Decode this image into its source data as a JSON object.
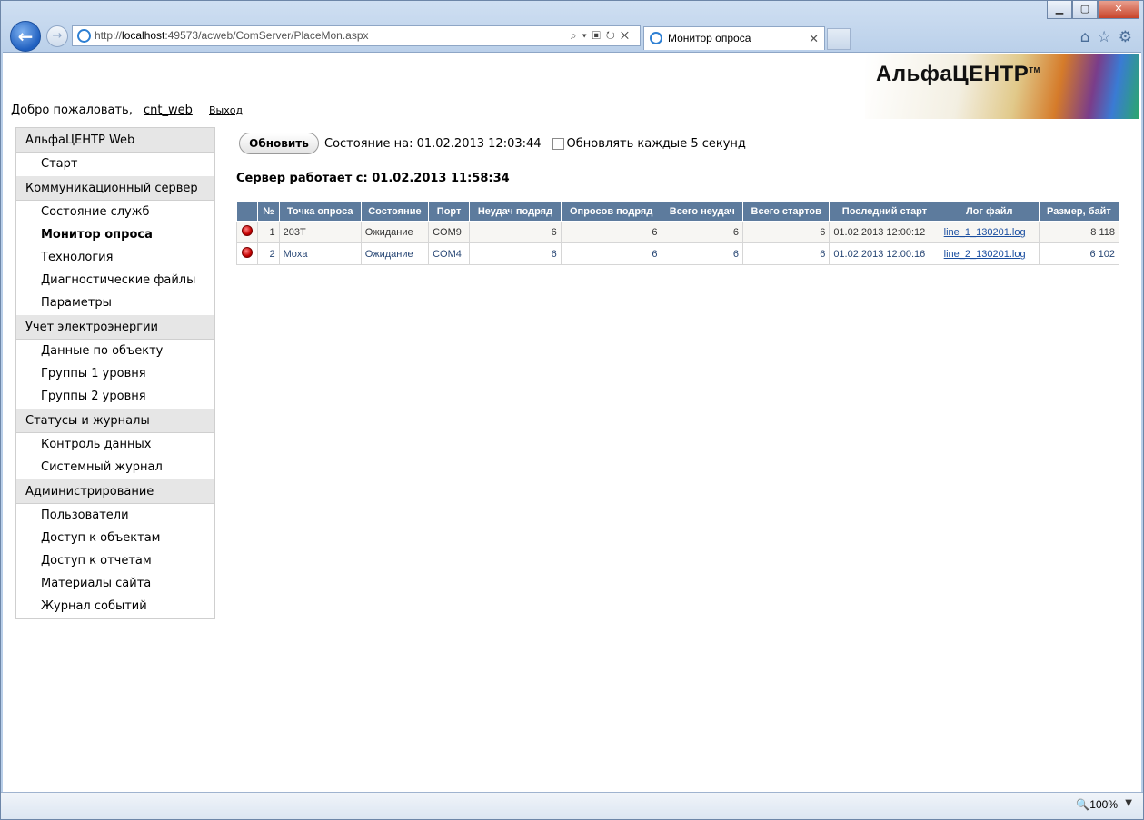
{
  "browser": {
    "address": {
      "prefix": "http://",
      "host": "localhost",
      "rest": ":49573/acweb/ComServer/PlaceMon.aspx"
    },
    "tab_title": "Монитор опроса",
    "tab_close": "✕",
    "zoom": "100%"
  },
  "logo": {
    "text": "АльфаЦЕНТР",
    "tm": "TM"
  },
  "header": {
    "welcome": "Добро пожаловать,",
    "user": "cnt_web",
    "logout": "Выход"
  },
  "sidebar": {
    "groups": [
      {
        "title": "АльфаЦЕНТР Web",
        "items": [
          "Старт"
        ]
      },
      {
        "title": "Коммуникационный сервер",
        "items": [
          "Состояние служб",
          "Монитор опроса",
          "Технология",
          "Диагностические файлы",
          "Параметры"
        ]
      },
      {
        "title": "Учет электроэнергии",
        "items": [
          "Данные по объекту",
          "Группы 1 уровня",
          "Группы 2 уровня"
        ]
      },
      {
        "title": "Статусы и журналы",
        "items": [
          "Контроль данных",
          "Системный журнал"
        ]
      },
      {
        "title": "Администрирование",
        "items": [
          "Пользователи",
          "Доступ к объектам",
          "Доступ к отчетам",
          "Материалы сайта",
          "Журнал событий"
        ]
      }
    ],
    "active": "Монитор опроса"
  },
  "toolbar": {
    "refresh_label": "Обновить",
    "status_text": "Состояние на: 01.02.2013 12:03:44",
    "auto_refresh_label": "Обновлять каждые 5 секунд"
  },
  "server_since": "Сервер работает с: 01.02.2013 11:58:34",
  "table": {
    "columns": [
      "",
      "№",
      "Точка опроса",
      "Состояние",
      "Порт",
      "Неудач подряд",
      "Опросов подряд",
      "Всего неудач",
      "Всего стартов",
      "Последний старт",
      "Лог файл",
      "Размер, байт"
    ],
    "rows": [
      {
        "status_color": "#c40000",
        "num": "1",
        "point": "203T",
        "state": "Ожидание",
        "port": "COM9",
        "fails_row": "6",
        "polls_row": "6",
        "fails_total": "6",
        "starts_total": "6",
        "last_start": "01.02.2013 12:00:12",
        "log": "line_1_130201.log",
        "size": "8 118"
      },
      {
        "status_color": "#c40000",
        "num": "2",
        "point": "Moxa",
        "state": "Ожидание",
        "port": "COM4",
        "fails_row": "6",
        "polls_row": "6",
        "fails_total": "6",
        "starts_total": "6",
        "last_start": "01.02.2013 12:00:16",
        "log": "line_2_130201.log",
        "size": "6 102"
      }
    ]
  }
}
